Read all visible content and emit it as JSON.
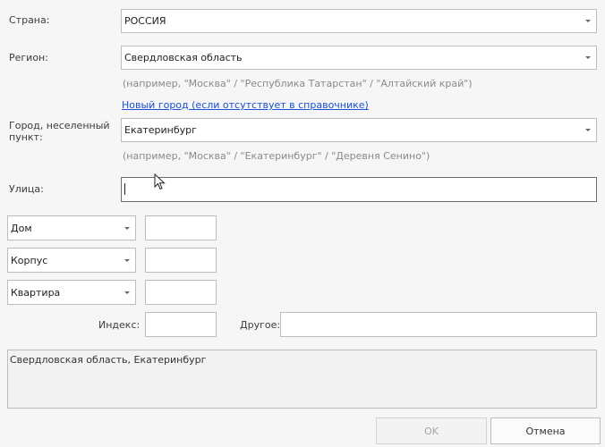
{
  "form": {
    "country": {
      "label": "Страна:",
      "value": "РОССИЯ"
    },
    "region": {
      "label": "Регион:",
      "value": "Свердловская область",
      "hint": "(например, \"Москва\" / \"Республика Татарстан\" / \"Алтайский край\")"
    },
    "new_city_link": "Новый город (если отсутствует в справочнике)",
    "city": {
      "label": "Город, неселенный пункт:",
      "value": "Екатеринбург",
      "hint": "(например, \"Москва\" / \"Екатеринбург\" / \"Деревня Сенино\")"
    },
    "street": {
      "label": "Улица:",
      "value": ""
    },
    "house": {
      "label": "Дом",
      "value": ""
    },
    "building": {
      "label": "Корпус",
      "value": ""
    },
    "apartment": {
      "label": "Квартира",
      "value": ""
    },
    "index": {
      "label": "Индекс:",
      "value": ""
    },
    "other": {
      "label": "Другое:",
      "value": ""
    },
    "summary": "Свердловская область, Екатеринбург"
  },
  "buttons": {
    "ok": "OK",
    "cancel": "Отмена"
  }
}
